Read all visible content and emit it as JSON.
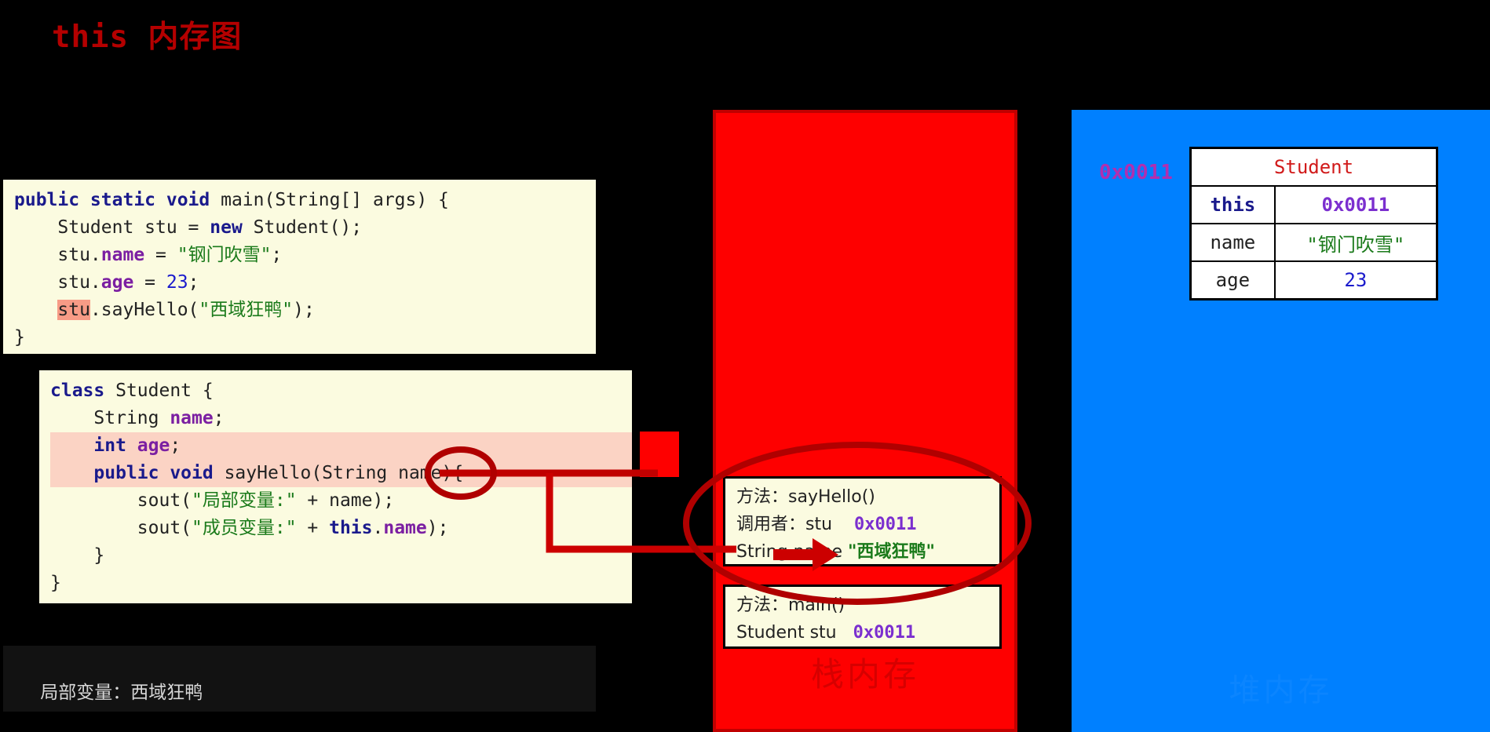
{
  "title": "this 内存图",
  "colors": {
    "title": "#b40000",
    "stack_bg": "#fe0000",
    "heap_bg": "#0080ff",
    "code_bg": "#fbfbe0",
    "highlight_token": "#f79b86",
    "highlight_line": "#fbd3c4",
    "keyword": "#1a1a8c",
    "string": "#1a7a1a",
    "number": "#1a1acc",
    "field": "#7b1fa2",
    "address": "#7b2fcf",
    "annotation": "#c00000",
    "console_bg": "#121212",
    "console_text": "#d8d8d8"
  },
  "code_main": {
    "lines": [
      [
        {
          "t": "public static void ",
          "c": "kw"
        },
        {
          "t": "main(String[] args) {",
          "c": "plain"
        }
      ],
      [
        {
          "t": "    Student stu = ",
          "c": "plain"
        },
        {
          "t": "new ",
          "c": "kw"
        },
        {
          "t": "Student();",
          "c": "plain"
        }
      ],
      [
        {
          "t": "    stu.",
          "c": "plain"
        },
        {
          "t": "name",
          "c": "fld"
        },
        {
          "t": " = ",
          "c": "plain"
        },
        {
          "t": "\"钢门吹雪\"",
          "c": "str"
        },
        {
          "t": ";",
          "c": "plain"
        }
      ],
      [
        {
          "t": "    stu.",
          "c": "plain"
        },
        {
          "t": "age",
          "c": "fld"
        },
        {
          "t": " = ",
          "c": "plain"
        },
        {
          "t": "23",
          "c": "num"
        },
        {
          "t": ";",
          "c": "plain"
        }
      ],
      [
        {
          "t": "    ",
          "c": "plain"
        },
        {
          "t": "stu",
          "c": "hl-tok"
        },
        {
          "t": ".sayHello(",
          "c": "plain"
        },
        {
          "t": "\"西域狂鸭\"",
          "c": "str"
        },
        {
          "t": ");",
          "c": "plain"
        }
      ],
      [
        {
          "t": "}",
          "c": "plain"
        }
      ]
    ]
  },
  "code_class": {
    "lines": [
      [
        {
          "t": "class ",
          "c": "kw"
        },
        {
          "t": "Student {",
          "c": "plain"
        }
      ],
      [
        {
          "t": "    String ",
          "c": "plain"
        },
        {
          "t": "name",
          "c": "fld"
        },
        {
          "t": ";",
          "c": "plain"
        }
      ],
      [
        {
          "t": "    ",
          "c": "plain"
        },
        {
          "t": "int ",
          "c": "kw"
        },
        {
          "t": "age",
          "c": "fld"
        },
        {
          "t": ";",
          "c": "plain"
        }
      ],
      [
        {
          "t": "    ",
          "c": "plain"
        },
        {
          "t": "public void ",
          "c": "kw"
        },
        {
          "t": "sayHello(String name){",
          "c": "plain"
        }
      ],
      [
        {
          "t": "        sout(",
          "c": "plain"
        },
        {
          "t": "\"局部变量:\"",
          "c": "str"
        },
        {
          "t": " + name);",
          "c": "plain"
        }
      ],
      [
        {
          "t": "        sout(",
          "c": "plain"
        },
        {
          "t": "\"成员变量:\"",
          "c": "str"
        },
        {
          "t": " + ",
          "c": "plain"
        },
        {
          "t": "this",
          "c": "kw"
        },
        {
          "t": ".",
          "c": "plain"
        },
        {
          "t": "name",
          "c": "fld"
        },
        {
          "t": ");",
          "c": "plain"
        }
      ],
      [
        {
          "t": "    }",
          "c": "plain"
        }
      ],
      [
        {
          "t": "}",
          "c": "plain"
        }
      ]
    ],
    "highlighted_line_indices": [
      2,
      3
    ]
  },
  "stack": {
    "watermark": "栈内存",
    "frames": [
      {
        "id": "sayHello",
        "rows": [
          [
            {
              "t": "方法：sayHello()",
              "c": "plain"
            }
          ],
          [
            {
              "t": "调用者：stu    ",
              "c": "plain"
            },
            {
              "t": "0x0011",
              "c": "addr"
            }
          ],
          [
            {
              "t": "String name ",
              "c": "plain"
            },
            {
              "t": "\"西域狂鸭\"",
              "c": "dgreen"
            }
          ]
        ]
      },
      {
        "id": "main",
        "rows": [
          [
            {
              "t": "方法：main()",
              "c": "plain"
            }
          ],
          [
            {
              "t": "Student stu   ",
              "c": "plain"
            },
            {
              "t": "0x0011",
              "c": "addr"
            }
          ]
        ]
      }
    ]
  },
  "heap": {
    "watermark": "堆内存",
    "address_label": "0x0011",
    "object_table": {
      "title": "Student",
      "rows": [
        {
          "key": "this",
          "value": "0x0011",
          "key_class": "t-this",
          "value_class": "t-addr"
        },
        {
          "key": "name",
          "value": "\"钢门吹雪\"",
          "key_class": "t-name",
          "value_class": "t-str"
        },
        {
          "key": "age",
          "value": "23",
          "key_class": "t-name",
          "value_class": "t-num"
        }
      ]
    }
  },
  "console": {
    "output": "局部变量：西域狂鸭"
  },
  "annotations": {
    "ellipse_param_name": "ellipse around sayHello parameter name",
    "ellipse_stack_frame": "ellipse around sayHello stack frame",
    "arrow_label": "arrow from method parameter to stack frame String name"
  }
}
